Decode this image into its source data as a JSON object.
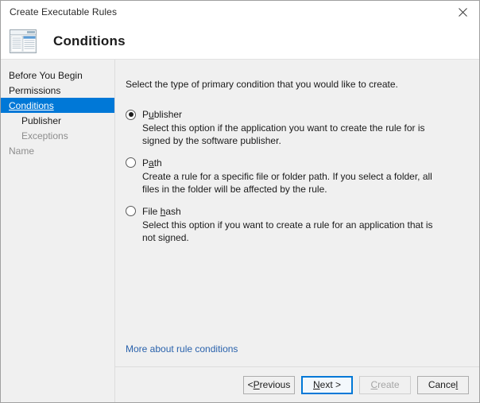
{
  "window": {
    "title": "Create Executable Rules",
    "close_icon": "close-icon"
  },
  "header": {
    "icon": "rules-window-icon",
    "title": "Conditions"
  },
  "sidebar": {
    "items": [
      {
        "label": "Before You Begin",
        "state": "normal",
        "indent": false
      },
      {
        "label": "Permissions",
        "state": "normal",
        "indent": false
      },
      {
        "label": "Conditions",
        "state": "selected",
        "indent": false
      },
      {
        "label": "Publisher",
        "state": "normal",
        "indent": true
      },
      {
        "label": "Exceptions",
        "state": "dim",
        "indent": true
      },
      {
        "label": "Name",
        "state": "dim",
        "indent": false
      }
    ],
    "selected_bg": "#0078d7"
  },
  "content": {
    "intro": "Select the type of primary condition that you would like to create.",
    "options": [
      {
        "label_pre": "P",
        "label_accel": "u",
        "label_post": "blisher",
        "checked": true,
        "description": "Select this option if the application you want to create the rule for is signed by the software publisher."
      },
      {
        "label_pre": "P",
        "label_accel": "a",
        "label_post": "th",
        "checked": false,
        "description": "Create a rule for a specific file or folder path. If you select a folder, all files in the folder will be affected by the rule."
      },
      {
        "label_pre": "File ",
        "label_accel": "h",
        "label_post": "ash",
        "checked": false,
        "description": "Select this option if you want to create a rule for an application that is not signed."
      }
    ],
    "help_link": "More about rule conditions",
    "link_color": "#2a62ac"
  },
  "footer": {
    "buttons": [
      {
        "pre": "< ",
        "accel": "P",
        "post": "revious",
        "state": "normal"
      },
      {
        "pre": "",
        "accel": "N",
        "post": "ext >",
        "state": "focused"
      },
      {
        "pre": "",
        "accel": "C",
        "post": "reate",
        "state": "disabled"
      },
      {
        "pre": "Cance",
        "accel": "l",
        "post": "",
        "state": "normal"
      }
    ],
    "focus_color": "#0078d7"
  }
}
